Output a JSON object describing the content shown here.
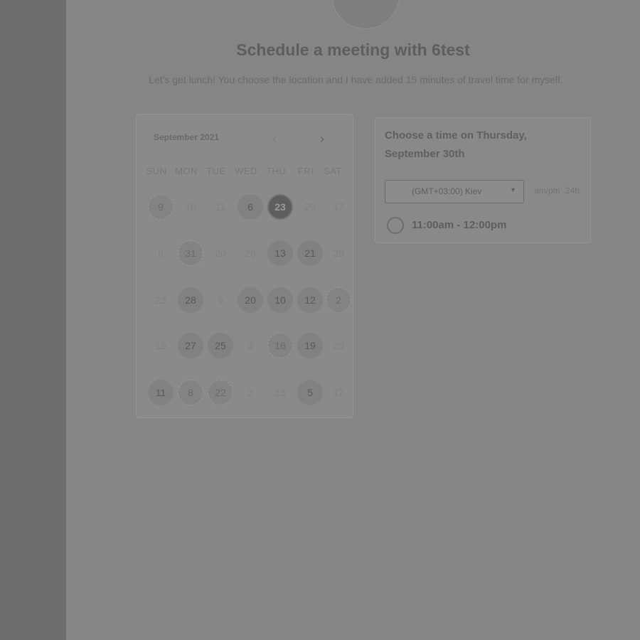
{
  "page": {
    "title": "Schedule a meeting with 6test",
    "description": "Let's get lunch! You choose the location and I have added 15 minutes of travel time for myself."
  },
  "calendar": {
    "month_label": "September 2021",
    "prev_icon": "chevron-left-icon",
    "next_icon": "chevron-right-icon",
    "weekdays": [
      "SUN",
      "MON",
      "TUE",
      "WED",
      "THU",
      "FRI",
      "SAT"
    ],
    "rows": [
      [
        {
          "label": "9",
          "state": "dotted"
        },
        {
          "label": "10",
          "state": "off"
        },
        {
          "label": "11",
          "state": "off"
        },
        {
          "label": "6",
          "state": "available"
        },
        {
          "label": "23",
          "state": "selected"
        },
        {
          "label": "20",
          "state": "off"
        },
        {
          "label": "17",
          "state": "off"
        }
      ],
      [
        {
          "label": "8",
          "state": "off"
        },
        {
          "label": "31",
          "state": "dotted"
        },
        {
          "label": "20",
          "state": "off"
        },
        {
          "label": "26",
          "state": "off"
        },
        {
          "label": "13",
          "state": "available"
        },
        {
          "label": "21",
          "state": "available"
        },
        {
          "label": "28",
          "state": "off"
        }
      ],
      [
        {
          "label": "23",
          "state": "off"
        },
        {
          "label": "28",
          "state": "available"
        },
        {
          "label": "9",
          "state": "off"
        },
        {
          "label": "20",
          "state": "available"
        },
        {
          "label": "10",
          "state": "available"
        },
        {
          "label": "12",
          "state": "available"
        },
        {
          "label": "2",
          "state": "dotted"
        }
      ],
      [
        {
          "label": "19",
          "state": "off"
        },
        {
          "label": "27",
          "state": "available"
        },
        {
          "label": "25",
          "state": "available"
        },
        {
          "label": "3",
          "state": "off"
        },
        {
          "label": "16",
          "state": "dotted"
        },
        {
          "label": "19",
          "state": "available"
        },
        {
          "label": "20",
          "state": "off"
        }
      ],
      [
        {
          "label": "11",
          "state": "available"
        },
        {
          "label": "8",
          "state": "dotted"
        },
        {
          "label": "22",
          "state": "dotted"
        },
        {
          "label": "2",
          "state": "off"
        },
        {
          "label": "13",
          "state": "off"
        },
        {
          "label": "5",
          "state": "available"
        },
        {
          "label": "17",
          "state": "off"
        }
      ]
    ]
  },
  "times": {
    "heading": "Choose a time on Thursday, September 30th",
    "timezone_value": "(GMT+03:00) Kiev",
    "dropdown_icon": "caret-down-icon",
    "format_toggle": "am/pm 24h",
    "slots": [
      {
        "label": "11:00am - 12:00pm"
      }
    ]
  }
}
